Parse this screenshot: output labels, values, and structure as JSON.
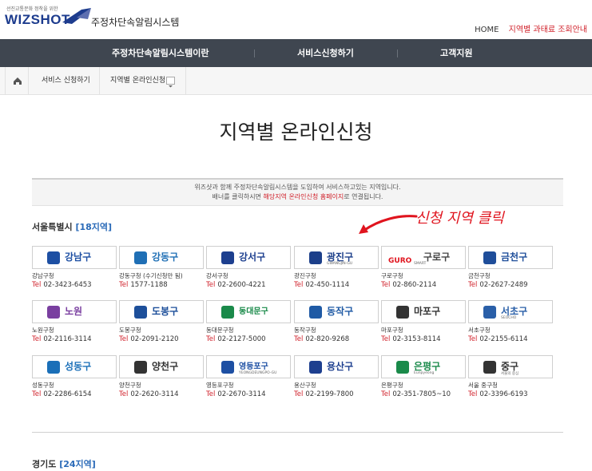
{
  "header": {
    "tagline": "선진교통문화 정착을 위한",
    "brand": "WIZSHOT",
    "system_name": "주정차단속알림시스템",
    "links": {
      "home": "HOME",
      "lookup": "지역별 과태료 조회안내"
    }
  },
  "nav": {
    "items": [
      "주정차단속알림시스템이란",
      "서비스신청하기",
      "고객지원"
    ]
  },
  "breadcrumb": {
    "items": [
      "서비스 신청하기",
      "지역별 온라인신청"
    ]
  },
  "page": {
    "title": "지역별 온라인신청",
    "notice_line1": "위즈샷과 함께 주정차단속알림시스템을 도입하여 서비스하고있는 지역입니다.",
    "notice_line2_pre": "배너를 클릭하시면 ",
    "notice_line2_hl": "해당지역 온라인신청 홈페이지",
    "notice_line2_post": "로 연결됩니다."
  },
  "annotation": "신청 지역 클릭",
  "tel_label": "Tel",
  "sections": [
    {
      "title": "서울특별시",
      "count": "[18지역]",
      "districts": [
        {
          "banner": "강남구",
          "name": "강남구청",
          "tel": "02-3423-6453",
          "color": "#1d4fa3"
        },
        {
          "banner": "강동구",
          "name": "강동구청 (수기신청만 됨)",
          "tel": "1577-1188",
          "color": "#1f6fb5"
        },
        {
          "banner": "강서구",
          "name": "강서구청",
          "tel": "02-2600-4221",
          "color": "#1d3f8f"
        },
        {
          "banner": "광진구",
          "sub": "GWANGJIN-GU",
          "name": "광진구청",
          "tel": "02-450-1114",
          "color": "#1c3f8a"
        },
        {
          "banner": "구로구",
          "sub": "SMART",
          "banner_alt": "GURO",
          "name": "구로구청",
          "tel": "02-860-2114",
          "color": "#444"
        },
        {
          "banner": "금천구",
          "name": "금천구청",
          "tel": "02-2627-2489",
          "color": "#1f4e9a"
        },
        {
          "banner": "노원",
          "name": "노원구청",
          "tel": "02-2116-3114",
          "color": "#7a3fa0"
        },
        {
          "banner": "도봉구",
          "name": "도봉구청",
          "tel": "02-2091-2120",
          "color": "#1d4f9a"
        },
        {
          "banner": "동대문구",
          "name": "동대문구청",
          "tel": "02-2127-5000",
          "color": "#1a8a4a"
        },
        {
          "banner": "동작구",
          "name": "동작구청",
          "tel": "02-820-9268",
          "color": "#1f5aa5"
        },
        {
          "banner": "마포구",
          "name": "마포구청",
          "tel": "02-3153-8114",
          "color": "#333"
        },
        {
          "banner": "서초구",
          "sub": "SEOCHO",
          "name": "서초구청",
          "tel": "02-2155-6114",
          "color": "#2a5fa8"
        },
        {
          "banner": "성동구",
          "name": "성동구청",
          "tel": "02-2286-6154",
          "color": "#1a6fb8"
        },
        {
          "banner": "양천구",
          "name": "양천구청",
          "tel": "02-2620-3114",
          "color": "#333"
        },
        {
          "banner": "영등포구",
          "sub": "YEONGDEUNGPO-GU",
          "name": "영등포구청",
          "tel": "02-2670-3114",
          "color": "#1d4fa3"
        },
        {
          "banner": "용산구",
          "name": "용산구청",
          "tel": "02-2199-7800",
          "color": "#1d3f8f"
        },
        {
          "banner": "은평구",
          "sub": "Eunpyeong",
          "name": "은평구청",
          "tel": "02-351-7805~10",
          "color": "#1a8a4a"
        },
        {
          "banner": "중구",
          "sub": "서울의 중심",
          "name": "서울 중구청",
          "tel": "02-3396-6193",
          "color": "#333"
        }
      ]
    },
    {
      "title": "경기도",
      "count": "[24지역]"
    }
  ]
}
